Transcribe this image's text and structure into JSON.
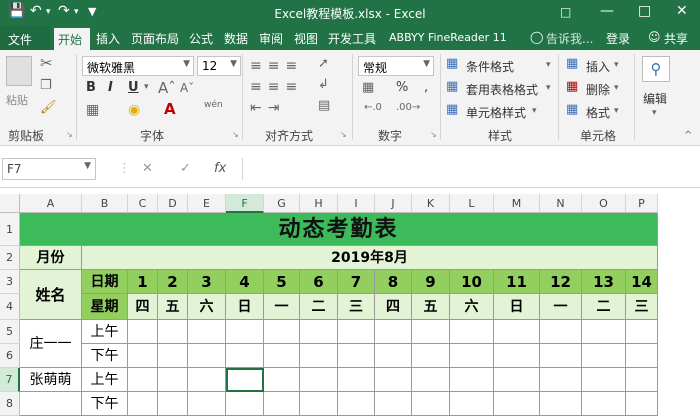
{
  "titlebar": {
    "title": "Excel教程模板.xlsx - Excel",
    "save_icon": "save-icon",
    "undo_icon": "undo-icon",
    "redo_icon": "redo-icon"
  },
  "tabs": [
    "文件",
    "开始",
    "插入",
    "页面布局",
    "公式",
    "数据",
    "审阅",
    "视图",
    "开发工具",
    "ABBYY FineReader 11"
  ],
  "tell_me": "告诉我...",
  "signin": "登录",
  "share": "共享",
  "ribbon": {
    "paste": "粘贴",
    "clipboard": "剪贴板",
    "font_name": "微软雅黑",
    "font_size": "12",
    "font_group": "字体",
    "align_group": "对齐方式",
    "number_format": "常规",
    "number_group": "数字",
    "cond_format": "条件格式",
    "table_format": "套用表格格式",
    "cell_style": "单元格样式",
    "styles_group": "样式",
    "insert": "插入",
    "delete": "删除",
    "format": "格式",
    "cells_group": "单元格",
    "edit": "编辑",
    "wen": "wén",
    "bold": "B",
    "italic": "I",
    "underline": "U",
    "fontA": "A",
    "pct": "%",
    "comma": ","
  },
  "namebox": "F7",
  "formula_fx": "fx",
  "columns": [
    "A",
    "B",
    "C",
    "D",
    "E",
    "F",
    "G",
    "H",
    "I",
    "J",
    "K",
    "L",
    "M",
    "N",
    "O",
    "P"
  ],
  "rows": [
    "1",
    "2",
    "3",
    "4",
    "5",
    "6",
    "7",
    "8"
  ],
  "sheet": {
    "title": "动态考勤表",
    "month_label": "月份",
    "month_value": "2019年8月",
    "name_header": "姓名",
    "date_label": "日期",
    "weekday_label": "星期",
    "dates": [
      "1",
      "2",
      "3",
      "4",
      "5",
      "6",
      "7",
      "8",
      "9",
      "10",
      "11",
      "12",
      "13",
      "14"
    ],
    "weekdays": [
      "四",
      "五",
      "六",
      "日",
      "一",
      "二",
      "三",
      "四",
      "五",
      "六",
      "日",
      "一",
      "二",
      "三"
    ],
    "people": [
      "庄一一",
      "张萌萌"
    ],
    "am": "上午",
    "pm": "下午"
  }
}
